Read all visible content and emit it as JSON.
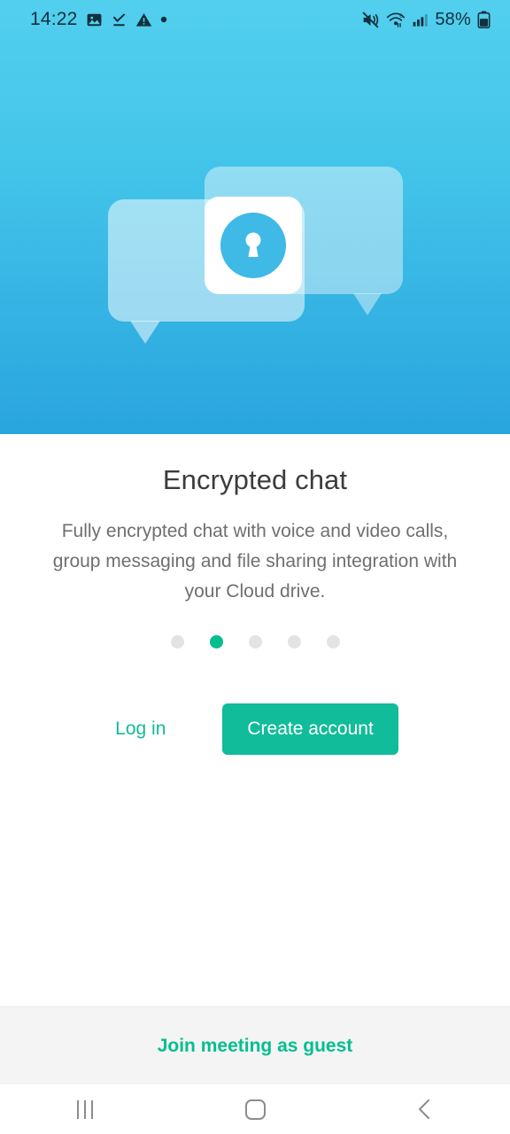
{
  "status_bar": {
    "time": "14:22",
    "left_icons": [
      "image-icon",
      "download-done-icon",
      "warning-icon",
      "dot-icon"
    ],
    "right_icons": [
      "mute-icon",
      "wifi-6-icon",
      "signal-bars-icon",
      "battery-icon"
    ],
    "battery_percent": "58%"
  },
  "hero": {
    "illustration": "encrypted-chat-bubbles-lock-illustration",
    "gradient_top": "#53CFEE",
    "gradient_bottom": "#29A5DE",
    "bubble_fill": "rgba(255,255,255,0.5)",
    "lock_circle_color": "#3FB9E5",
    "lock_icon": "keyhole-icon"
  },
  "onboarding": {
    "title": "Encrypted chat",
    "description": "Fully encrypted chat with voice and video calls, group messaging and file sharing integration with your Cloud drive.",
    "pager": {
      "total": 5,
      "active_index": 1,
      "active_color": "#04BE8E",
      "inactive_color": "#E3E3E3"
    }
  },
  "actions": {
    "login_label": "Log in",
    "create_account_label": "Create account",
    "accent_color": "#11BC9A"
  },
  "guest_bar": {
    "label": "Join meeting as guest",
    "color": "#04BE8E",
    "background": "#F4F4F4"
  },
  "nav_bar": {
    "recents_icon": "recents-icon",
    "home_icon": "home-icon",
    "back_icon": "back-chevron-icon"
  }
}
